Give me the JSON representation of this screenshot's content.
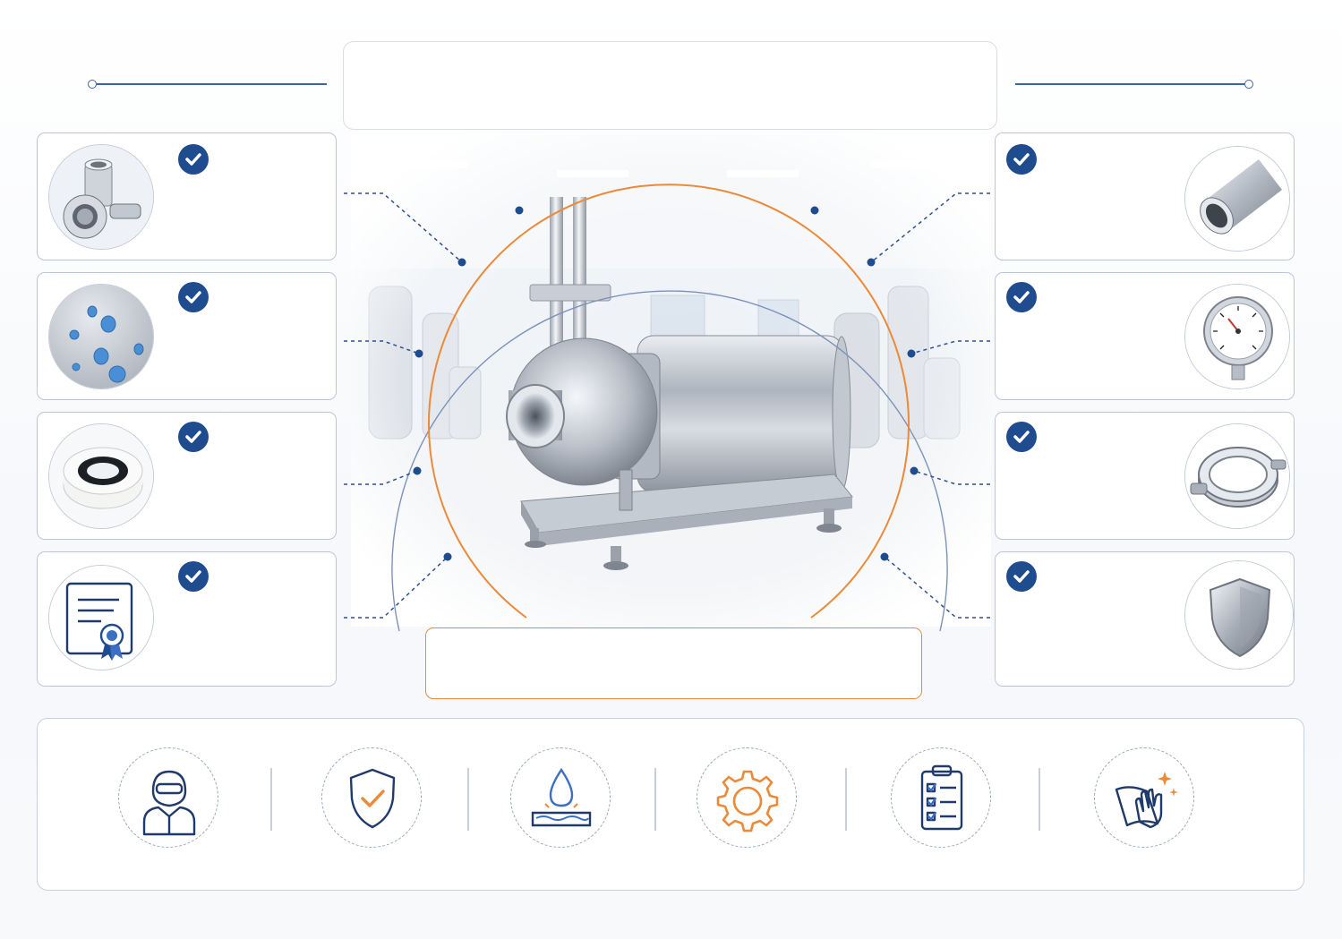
{
  "colors": {
    "navy": "#1f4b8f",
    "line_blue": "#3f63a6",
    "accent_orange": "#ec8a3a",
    "card_border": "#bcc6d8",
    "steel": "#c9ced6"
  },
  "title": {
    "text": ""
  },
  "caption": {
    "text": ""
  },
  "main_image": {
    "subject": "stainless-steel-centrifugal-pump-in-cleanroom"
  },
  "left_features": [
    {
      "icon": "tri-clamp-fitting-icon",
      "label": ""
    },
    {
      "icon": "water-droplets-surface-icon",
      "label": ""
    },
    {
      "icon": "gasket-seal-icon",
      "label": ""
    },
    {
      "icon": "certificate-icon",
      "label": ""
    }
  ],
  "right_features": [
    {
      "icon": "steel-tube-icon",
      "label": ""
    },
    {
      "icon": "pressure-gauge-icon",
      "label": ""
    },
    {
      "icon": "clamp-ring-icon",
      "label": ""
    },
    {
      "icon": "metal-shield-icon",
      "label": ""
    }
  ],
  "bottom_icons": [
    {
      "icon": "cleanroom-operator-icon",
      "label": ""
    },
    {
      "icon": "safety-shield-check-icon",
      "label": ""
    },
    {
      "icon": "water-drop-drain-icon",
      "label": ""
    },
    {
      "icon": "gear-icon",
      "label": ""
    },
    {
      "icon": "checklist-clipboard-icon",
      "label": ""
    },
    {
      "icon": "wiping-cleaning-icon",
      "label": ""
    }
  ]
}
